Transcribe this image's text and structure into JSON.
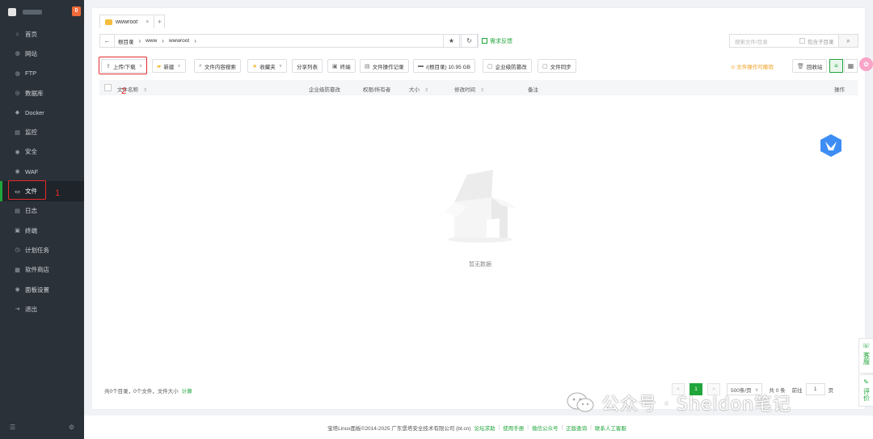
{
  "sidebar": {
    "badge": "0",
    "items": [
      {
        "label": "首页",
        "icon": "home-icon",
        "glyph": "⌂"
      },
      {
        "label": "网站",
        "icon": "globe-icon",
        "glyph": "◍"
      },
      {
        "label": "FTP",
        "icon": "ftp-icon",
        "glyph": "◍"
      },
      {
        "label": "数据库",
        "icon": "database-icon",
        "glyph": "◎"
      },
      {
        "label": "Docker",
        "icon": "docker-icon",
        "glyph": "◆"
      },
      {
        "label": "监控",
        "icon": "monitor-icon",
        "glyph": "▤"
      },
      {
        "label": "安全",
        "icon": "shield-icon",
        "glyph": "◉"
      },
      {
        "label": "WAF",
        "icon": "waf-icon",
        "glyph": "◉"
      },
      {
        "label": "文件",
        "icon": "folder-icon",
        "glyph": "▭"
      },
      {
        "label": "日志",
        "icon": "log-icon",
        "glyph": "▤"
      },
      {
        "label": "终端",
        "icon": "terminal-icon",
        "glyph": "▣"
      },
      {
        "label": "计划任务",
        "icon": "clock-icon",
        "glyph": "◷"
      },
      {
        "label": "软件商店",
        "icon": "store-icon",
        "glyph": "▦"
      },
      {
        "label": "面板设置",
        "icon": "settings-icon",
        "glyph": "◉"
      },
      {
        "label": "退出",
        "icon": "logout-icon",
        "glyph": "⇥"
      }
    ],
    "annotation": "1"
  },
  "tabs": [
    {
      "label": "wwwroot",
      "close": "×"
    }
  ],
  "tab_add": "+",
  "path": {
    "back": "←",
    "crumbs": [
      "根目录",
      "www",
      "wwwroot"
    ],
    "star": "★",
    "refresh": "↻",
    "feedback": "需求反馈"
  },
  "search": {
    "placeholder": "搜索文件/目录",
    "sub_label": "包含子目录",
    "button": "⌕"
  },
  "toolbar": {
    "upload": "上传/下载",
    "new": "新建",
    "content_search": "文件内容搜索",
    "favorites": "收藏夹",
    "share_list": "分享列表",
    "terminal": "终端",
    "op_log": "文件操作记录",
    "disk": "/(根目录) 10.95 GB",
    "enterprise": "企业级防篡改",
    "sync": "文件同步",
    "warning": "文件操作可撤销",
    "recycle": "回收站",
    "annotation": "2"
  },
  "table": {
    "headers": {
      "name": "文件名称",
      "tamper": "企业级防篡改",
      "perm": "权限/所有者",
      "size": "大小",
      "mtime": "修改时间",
      "note": "备注",
      "ops": "操作"
    }
  },
  "empty_text": "暂无数据",
  "footer": {
    "summary": "共0个目录，0个文件，文件大小",
    "calc": "计算",
    "prev": "<",
    "page": "1",
    "next": ">",
    "per_page": "500条/页",
    "total": "共 0 条",
    "goto": "前往",
    "goto_value": "1",
    "page_unit": "页"
  },
  "bottom": {
    "copyright": "宝塔Linux面板©2014-2025 广东堡塔安全技术有限公司 (bt.cn)",
    "links": [
      "论坛求助",
      "使用手册",
      "微信公众号",
      "正版查询",
      "联系人工客服"
    ]
  },
  "side_tabs": {
    "service": "客服",
    "review": "评价"
  },
  "watermark": "公众号 · Sheldon笔记",
  "colors": {
    "accent": "#20a53a",
    "sidebar": "#2b3138",
    "highlight": "#e62b2b",
    "badge": "#f06b3a"
  }
}
